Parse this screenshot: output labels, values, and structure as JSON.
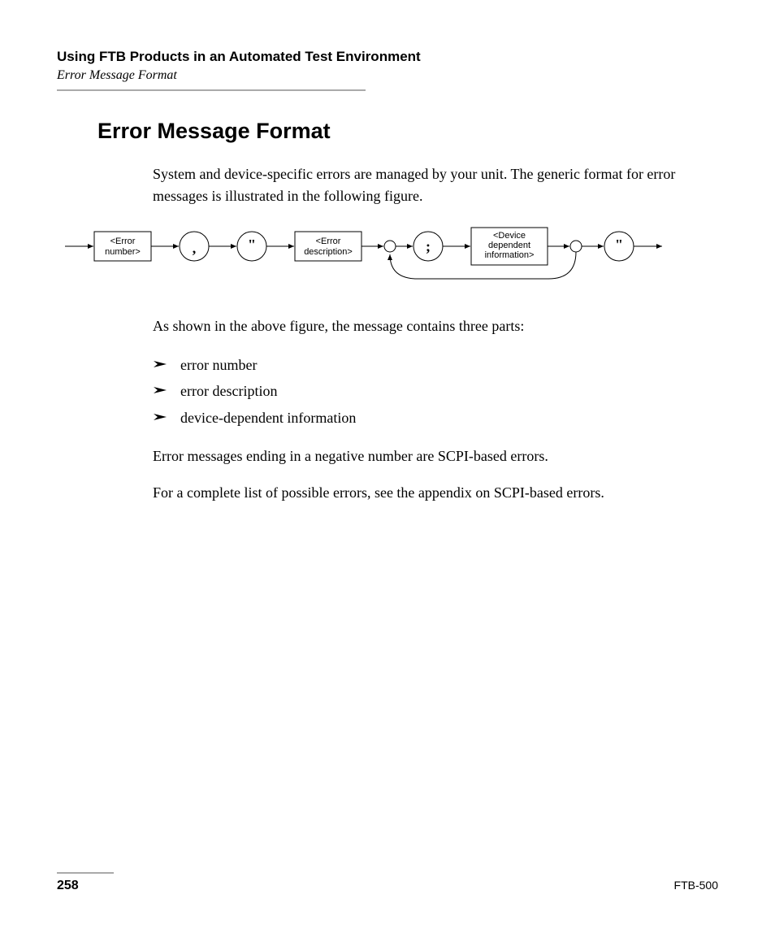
{
  "header": {
    "chapter": "Using FTB Products in an Automated Test Environment",
    "section": "Error Message Format"
  },
  "heading": "Error Message Format",
  "intro": "System and device-specific errors are managed by your unit. The generic format for error messages is illustrated in the following figure.",
  "diagram": {
    "nodes": {
      "error_number": "<Error number>",
      "comma": ",",
      "quote1": "\"",
      "error_description": "<Error description>",
      "semicolon": ";",
      "device_info": "<Device dependent information>",
      "quote2": "\""
    }
  },
  "after_diagram": "As shown in the above figure, the message contains three parts:",
  "list": [
    "error number",
    "error description",
    "device-dependent information"
  ],
  "para_scpi": "Error messages ending in a negative number are SCPI-based errors.",
  "para_appendix": "For a complete list of possible errors, see the appendix on SCPI-based errors.",
  "footer": {
    "page": "258",
    "model": "FTB-500"
  }
}
